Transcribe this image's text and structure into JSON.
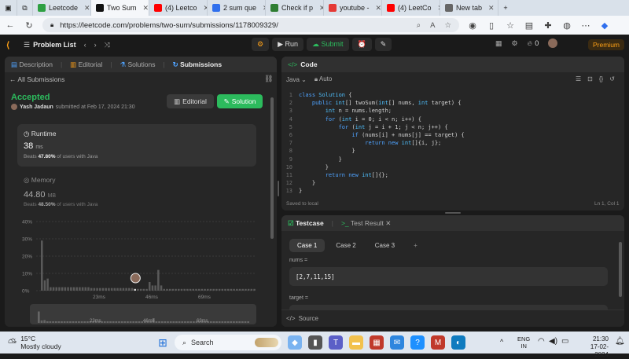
{
  "browser": {
    "tabs": [
      {
        "label": "Leetcode",
        "color": "#2ea043",
        "active": false
      },
      {
        "label": "Two Sum",
        "color": "#111111",
        "active": true
      },
      {
        "label": "(4) Leetco",
        "color": "#ff0000",
        "active": false
      },
      {
        "label": "2 sum que",
        "color": "#2f6fed",
        "active": false
      },
      {
        "label": "Check if p",
        "color": "#2e7d32",
        "active": false
      },
      {
        "label": "youtube -",
        "color": "#e53935",
        "active": false
      },
      {
        "label": "(4) LeetCo",
        "color": "#ff0000",
        "active": false
      },
      {
        "label": "New tab",
        "color": "#666666",
        "active": false
      }
    ],
    "url": "https://leetcode.com/problems/two-sum/submissions/1178009329/"
  },
  "nav": {
    "problem_list": "Problem List",
    "run": "Run",
    "submit": "Submit",
    "streak": "0",
    "premium": "Premium"
  },
  "left": {
    "tabs": [
      "Description",
      "Editorial",
      "Solutions",
      "Submissions"
    ],
    "back": "All Submissions",
    "status": "Accepted",
    "user": "Yash Jadaun",
    "submitted": "submitted at Feb 17, 2024 21:30",
    "editorial_btn": "Editorial",
    "solution_btn": "Solution",
    "runtime_label": "Runtime",
    "runtime_value": "38",
    "runtime_unit": "ms",
    "runtime_beats_pre": "Beats",
    "runtime_beats": "47.80%",
    "runtime_beats_post": "of users with Java",
    "memory_label": "Memory",
    "memory_value": "44.80",
    "memory_unit": "MB",
    "memory_beats_pre": "Beats",
    "memory_beats": "48.50%",
    "memory_beats_post": "of users with Java",
    "y_ticks": [
      "40%",
      "30%",
      "20%",
      "10%",
      "0%"
    ],
    "x_ticks": [
      "23ms",
      "46ms",
      "69ms"
    ],
    "mini_ticks": [
      "23ms",
      "46ms",
      "69ms"
    ]
  },
  "code": {
    "title": "Code",
    "language": "Java",
    "auto": "Auto",
    "saved": "Saved to local",
    "cursor": "Ln 1, Col 1"
  },
  "code_lines": [
    [
      [
        "kw",
        "class "
      ],
      [
        "ty",
        "Solution "
      ],
      [
        "tx",
        "{"
      ]
    ],
    [
      [
        "tx",
        "    "
      ],
      [
        "kw",
        "public "
      ],
      [
        "ty",
        "int"
      ],
      [
        "tx",
        "[] twoSum("
      ],
      [
        "ty",
        "int"
      ],
      [
        "tx",
        "[] nums, "
      ],
      [
        "ty",
        "int "
      ],
      [
        "tx",
        "target) {"
      ]
    ],
    [
      [
        "tx",
        "        "
      ],
      [
        "ty",
        "int "
      ],
      [
        "tx",
        "n = nums.length;"
      ]
    ],
    [
      [
        "tx",
        "        "
      ],
      [
        "kw",
        "for "
      ],
      [
        "tx",
        "("
      ],
      [
        "ty",
        "int "
      ],
      [
        "tx",
        "i = 0; i < n; i++) {"
      ]
    ],
    [
      [
        "tx",
        "            "
      ],
      [
        "kw",
        "for "
      ],
      [
        "tx",
        "("
      ],
      [
        "ty",
        "int "
      ],
      [
        "tx",
        "j = i + 1; j < n; j++) {"
      ]
    ],
    [
      [
        "tx",
        "                "
      ],
      [
        "kw",
        "if "
      ],
      [
        "tx",
        "(nums[i] + nums[j] == target) {"
      ]
    ],
    [
      [
        "tx",
        "                    "
      ],
      [
        "kw",
        "return new "
      ],
      [
        "ty",
        "int"
      ],
      [
        "tx",
        "[]{i, j};"
      ]
    ],
    [
      [
        "tx",
        "                }"
      ]
    ],
    [
      [
        "tx",
        "            }"
      ]
    ],
    [
      [
        "tx",
        "        }"
      ]
    ],
    [
      [
        "tx",
        "        "
      ],
      [
        "kw",
        "return new "
      ],
      [
        "ty",
        "int"
      ],
      [
        "tx",
        "[]{};"
      ]
    ],
    [
      [
        "tx",
        "    }"
      ]
    ],
    [
      [
        "tx",
        "}"
      ]
    ]
  ],
  "testcase": {
    "tab_label": "Testcase",
    "result_label": "Test Result",
    "cases": [
      "Case 1",
      "Case 2",
      "Case 3"
    ],
    "add": "+",
    "nums_label": "nums =",
    "nums_value": "[2,7,11,15]",
    "target_label": "target =",
    "source": "Source"
  },
  "taskbar": {
    "temp": "15°C",
    "weather": "Mostly cloudy",
    "search": "Search",
    "lang1": "ENG",
    "lang2": "IN",
    "time": "21:30",
    "date": "17-02-2024"
  },
  "chart_data": {
    "type": "bar",
    "title": "",
    "xlabel": "",
    "ylabel": "",
    "ylim": [
      0,
      40
    ],
    "x_ticks": [
      "23ms",
      "46ms",
      "69ms"
    ],
    "y_ticks": [
      "0%",
      "10%",
      "20%",
      "30%",
      "40%"
    ],
    "values": [
      29,
      6,
      7,
      2,
      2,
      2,
      2,
      2,
      2,
      2,
      2,
      2,
      2,
      2,
      2,
      2,
      2,
      1.5,
      1.5,
      1.5,
      1.5,
      1.5,
      1.5,
      1.5,
      1.5,
      1.5,
      1.5,
      1.5,
      1.5,
      1.5,
      1.5,
      1.5,
      1,
      1,
      1,
      1,
      1,
      5,
      3,
      3,
      12,
      3,
      1,
      1,
      1,
      1,
      1,
      1,
      1,
      1,
      1,
      1,
      1,
      1,
      1,
      1,
      1,
      1,
      1,
      1,
      1,
      1,
      1,
      1,
      1,
      1,
      1,
      1,
      1,
      1,
      1,
      1,
      1,
      1
    ],
    "highlight_index": 32
  }
}
